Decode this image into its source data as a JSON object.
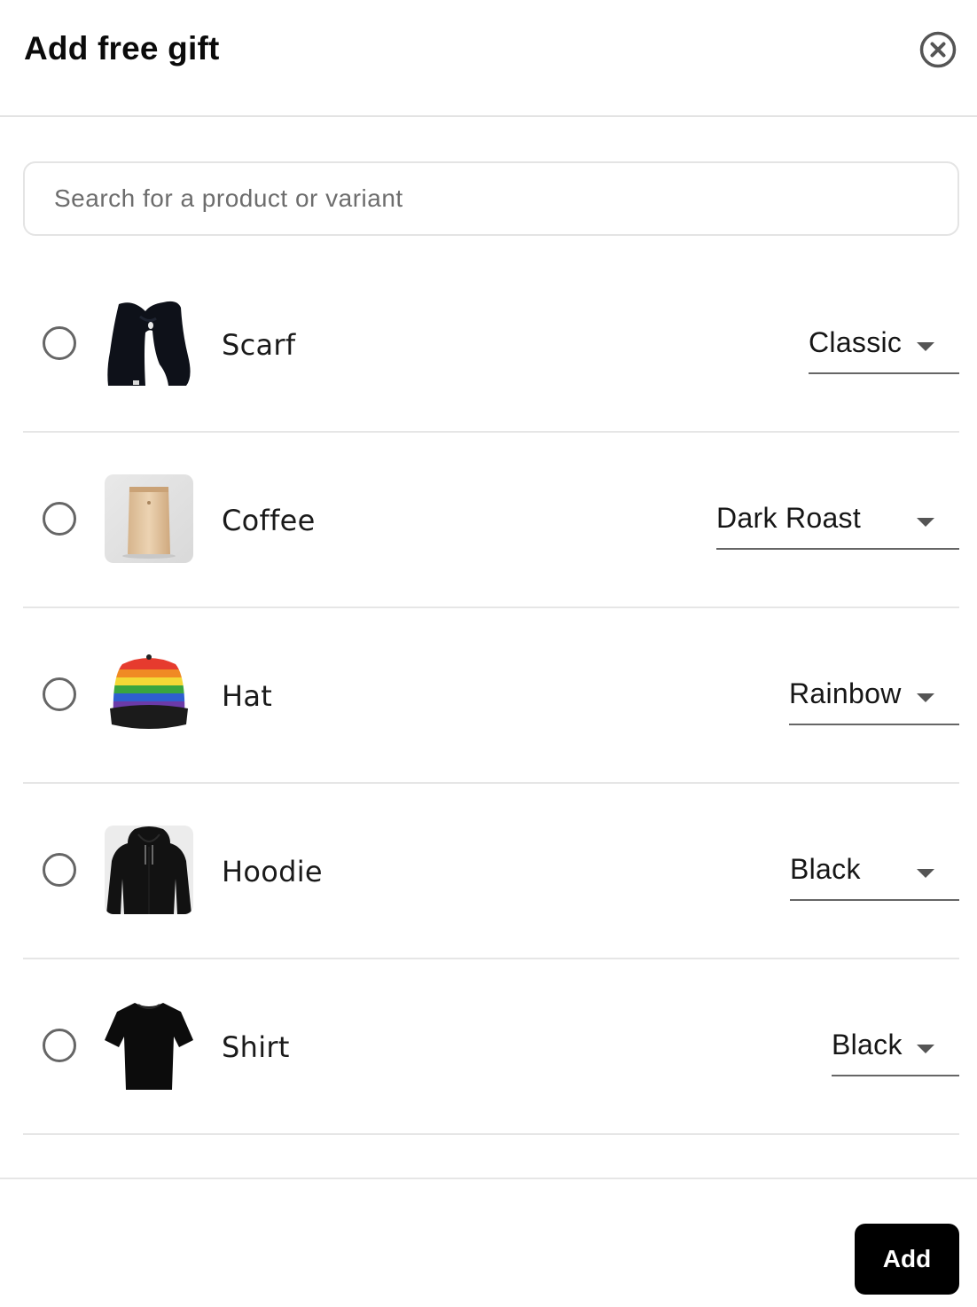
{
  "modal": {
    "title": "Add free gift",
    "close_icon": "close-circle-icon"
  },
  "search": {
    "placeholder": "Search for a product or variant",
    "value": ""
  },
  "products": [
    {
      "name": "Scarf",
      "variant": "Classic",
      "image": "scarf-image"
    },
    {
      "name": "Coffee",
      "variant": "Dark Roast",
      "image": "coffee-bag-image"
    },
    {
      "name": "Hat",
      "variant": "Rainbow",
      "image": "rainbow-cap-image"
    },
    {
      "name": "Hoodie",
      "variant": "Black",
      "image": "hoodie-image"
    },
    {
      "name": "Shirt",
      "variant": "Black",
      "image": "tshirt-image"
    }
  ],
  "footer": {
    "add_label": "Add"
  },
  "colors": {
    "primary_button": "#000000",
    "divider": "#e6e6e6",
    "radio_border": "#666666"
  }
}
